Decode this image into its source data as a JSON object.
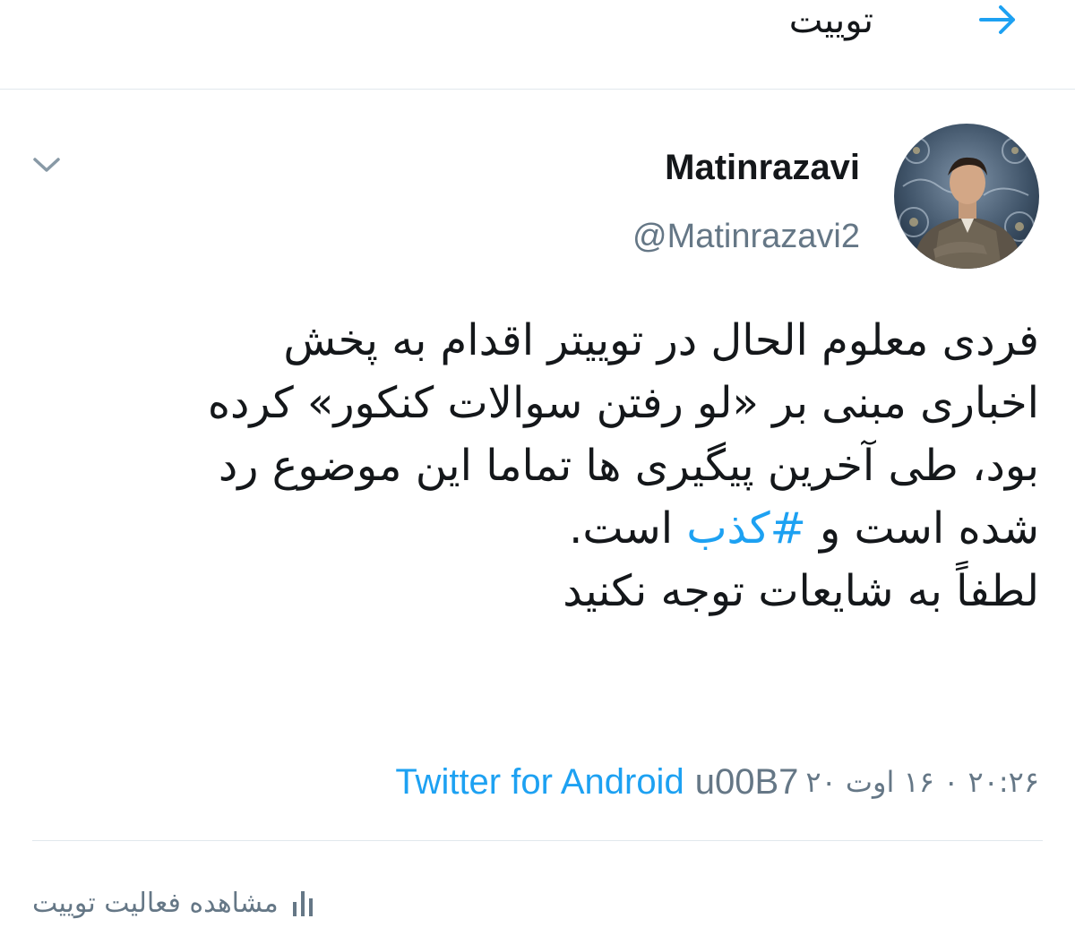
{
  "header": {
    "title": "توییت"
  },
  "tweet": {
    "display_name": "Matinrazavi",
    "handle": "@Matinrazavi2",
    "lines": [
      "فردی معلوم الحال در توییتر اقدام به پخش",
      "اخباری مبنی بر «لو رفتن سوالات کنکور» کرده",
      "بود، طی آخرین پیگیری ها تماما این موضوع رد"
    ],
    "line4_before": "شده است و ",
    "hashtag": "#کذب",
    "line4_after": " است.",
    "line5": "لطفاً به شایعات توجه نکنید",
    "date": "۲۰:۲۶ ۰ ۱۶ اوت ۲۰",
    "separator": "u00B7",
    "source": "Twitter for Android"
  },
  "activity": {
    "label": "مشاهده فعالیت توییت"
  },
  "colors": {
    "link": "#1da1f2",
    "secondary_text": "#657786",
    "divider": "#e1e8ed"
  }
}
